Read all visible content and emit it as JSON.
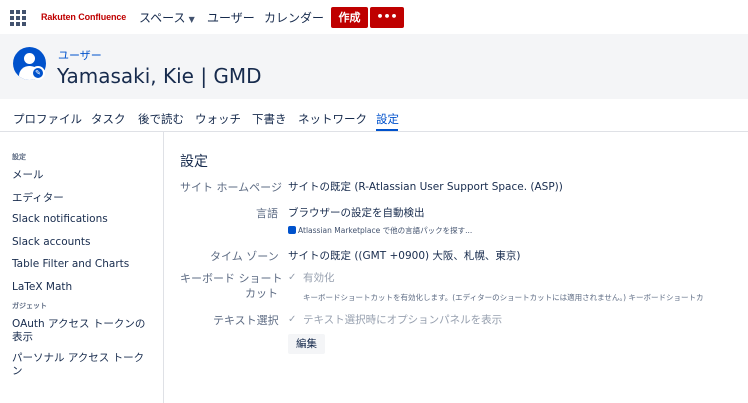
{
  "topnav": {
    "logo": "Rakuten Confluence",
    "items": [
      {
        "label": "スペース"
      },
      {
        "label": "ユーザー"
      },
      {
        "label": "カレンダー"
      }
    ],
    "create_label": "作成",
    "more_label": "•••"
  },
  "header": {
    "section_label": "ユーザー",
    "name": "Yamasaki, Kie | GMD"
  },
  "tabs": [
    {
      "label": "プロファイル"
    },
    {
      "label": "タスク"
    },
    {
      "label": "後で読む"
    },
    {
      "label": "ウォッチ"
    },
    {
      "label": "下書き"
    },
    {
      "label": "ネットワーク"
    },
    {
      "label": "設定",
      "active": true
    }
  ],
  "sidebar": {
    "settings_heading": "設定",
    "items": [
      {
        "label": "メール"
      },
      {
        "label": "エディター"
      },
      {
        "label": "Slack notifications"
      },
      {
        "label": "Slack accounts"
      },
      {
        "label": "Table Filter and Charts"
      },
      {
        "label": "LaTeX Math"
      }
    ],
    "gadget_heading": "ガジェット",
    "gadget_items": [
      {
        "label": "OAuth アクセス トークンの表示"
      },
      {
        "label": "パーソナル アクセス トークン"
      }
    ]
  },
  "main": {
    "title": "設定",
    "site_home_label": "サイト ホームページ",
    "site_home_value": "サイトの既定 (R-Atlassian User Support Space. (ASP))",
    "language_label": "言語",
    "language_value": "ブラウザーの設定を自動検出",
    "marketplace_text": "Atlassian Marketplace で他の言語パックを探す...",
    "timezone_label": "タイム ゾーン",
    "timezone_value": "サイトの既定 ((GMT +0900) 大阪、札幌、東京)",
    "keyboard_label_line1": "キーボード ショート",
    "keyboard_label_line2": "カット",
    "keyboard_value": "有効化",
    "keyboard_hint": "キーボードショートカットを有効化します。(エディターのショートカットには適用されません。) キーボードショートカ",
    "text_select_label": "テキスト選択",
    "text_select_value": "テキスト選択時にオプションパネルを表示",
    "edit_label": "編集"
  },
  "colors": {
    "brand_red": "#bf0000",
    "accent_blue": "#0052cc"
  }
}
